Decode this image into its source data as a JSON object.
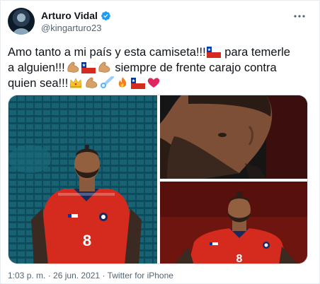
{
  "user": {
    "display_name": "Arturo Vidal",
    "handle": "@kingarturo23",
    "verified_icon": "verified-badge-icon",
    "verified_color": "#1d9bf0"
  },
  "tweet": {
    "line1_a": "Amo tanto a mi país y esta camiseta!!!",
    "line1_b": " para temerle",
    "line2_a": "a alguien!!!",
    "line2_b": " siempre de frente carajo contra",
    "line3_a": "quien sea!!!",
    "emojis": [
      "flexed-biceps",
      "chile-flag",
      "crown",
      "comet",
      "fire",
      "red-heart"
    ]
  },
  "media": {
    "photos": [
      {
        "name": "photo-vidal-stadium-anthem"
      },
      {
        "name": "photo-vidal-closeup-profile"
      },
      {
        "name": "photo-vidal-red-jersey"
      }
    ]
  },
  "footer": {
    "time": "1:03 p. m.",
    "separator": " · ",
    "date": "26 jun. 2021",
    "source": "Twitter for iPhone"
  },
  "colors": {
    "text": "#0f1419",
    "secondary": "#536471",
    "jersey_red": "#d52b1e"
  }
}
